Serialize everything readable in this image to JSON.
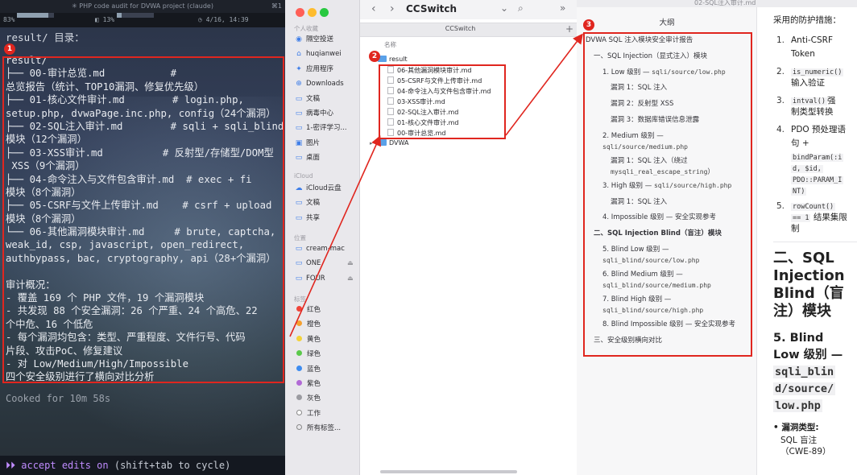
{
  "terminal": {
    "window_title": "✳ PHP code audit for DVWA project (claude)",
    "window_shortcut": "⌘1",
    "status": {
      "cpu_label": "83%",
      "cpu_value": 83,
      "mem_label": "13%",
      "mem_value": 13,
      "clock": "4/16, 14:39"
    },
    "prompt": "result/ 目录：",
    "tree_lines": [
      "result/",
      "├── 00-审计总览.md           #",
      "总览报告（统计、TOP10漏洞、修复优先级）",
      "├── 01-核心文件审计.md        # login.php,",
      "setup.php, dvwaPage.inc.php, config（24个漏洞）",
      "├── 02-SQL注入审计.md        # sqli + sqli_blind",
      "模块（12个漏洞）",
      "├── 03-XSS审计.md          # 反射型/存储型/DOM型",
      " XSS（9个漏洞）",
      "├── 04-命令注入与文件包含审计.md  # exec + fi",
      "模块（8个漏洞）",
      "├── 05-CSRF与文件上传审计.md    # csrf + upload",
      "模块（8个漏洞）",
      "└── 06-其他漏洞模块审计.md     # brute, captcha,",
      "weak_id, csp, javascript, open_redirect,",
      "authbypass, bac, cryptography, api（28+个漏洞）",
      "",
      "审计概况：",
      "- 覆盖 169 个 PHP 文件，19 个漏洞模块",
      "- 共发现 88 个安全漏洞：26 个严重、24 个高危、22",
      "个中危、16 个低危",
      "- 每个漏洞均包含：类型、严重程度、文件行号、代码",
      "片段、攻击PoC、修复建议",
      "- 对 Low/Medium/High/Impossible",
      "四个安全级别进行了横向对比分析"
    ],
    "cooked": "Cooked for 10m 58s",
    "footer_prefix": "⏵⏵",
    "footer_accent": "accept edits on",
    "footer_hint": "(shift+tab to cycle)"
  },
  "badges": [
    "1",
    "2",
    "3"
  ],
  "finder": {
    "sidebar": {
      "section_personal": "个人收藏",
      "personal": [
        {
          "label": "隔空投送",
          "icon": "airdrop-icon",
          "glyph": "◉"
        },
        {
          "label": "huqianwei",
          "icon": "home-icon",
          "glyph": "⌂"
        },
        {
          "label": "应用程序",
          "icon": "applications-icon",
          "glyph": "✦"
        },
        {
          "label": "Downloads",
          "icon": "downloads-icon",
          "glyph": "⊕"
        },
        {
          "label": "文稿",
          "icon": "documents-icon",
          "glyph": "▭"
        },
        {
          "label": "病毒中心",
          "icon": "folder-icon",
          "glyph": "▭"
        },
        {
          "label": "1-密评学习...",
          "icon": "folder-icon",
          "glyph": "▭"
        },
        {
          "label": "图片",
          "icon": "pictures-icon",
          "glyph": "▣"
        },
        {
          "label": "桌面",
          "icon": "desktop-icon",
          "glyph": "▭"
        }
      ],
      "section_icloud": "iCloud",
      "icloud": [
        {
          "label": "iCloud云盘",
          "icon": "icloud-icon",
          "glyph": "☁"
        },
        {
          "label": "文稿",
          "icon": "documents-icon",
          "glyph": "▭"
        },
        {
          "label": "共享",
          "icon": "shared-icon",
          "glyph": "▭"
        }
      ],
      "section_locations": "位置",
      "locations": [
        {
          "label": "cream-mac",
          "icon": "computer-icon",
          "glyph": "▭",
          "eject": ""
        },
        {
          "label": "ONE",
          "icon": "drive-icon",
          "glyph": "▭",
          "eject": "⏏"
        },
        {
          "label": "FOUR",
          "icon": "drive-icon",
          "glyph": "▭",
          "eject": "⏏"
        }
      ],
      "section_tags": "标签",
      "tags": [
        {
          "label": "红色",
          "color": "#f0443a"
        },
        {
          "label": "橙色",
          "color": "#f5a02f"
        },
        {
          "label": "黄色",
          "color": "#f3d23b"
        },
        {
          "label": "绿色",
          "color": "#5bc94b"
        },
        {
          "label": "蓝色",
          "color": "#3e8cf0"
        },
        {
          "label": "紫色",
          "color": "#b26ad6"
        },
        {
          "label": "灰色",
          "color": "#9b9ba1"
        },
        {
          "label": "工作",
          "color": "#ffffff"
        },
        {
          "label": "所有标签...",
          "color": ""
        }
      ]
    },
    "toolbar": {
      "back": "‹",
      "forward": "›",
      "title": "CCSwitch",
      "chevron": "⌄",
      "search": "⌕",
      "more": "»"
    },
    "tab": "CCSwitch",
    "plus": "+",
    "column_name": "名称",
    "root_folder": "result",
    "files": [
      "06-其他漏洞模块审计.md",
      "05-CSRF与文件上传审计.md",
      "04-命令注入与文件包含审计.md",
      "03-XSS审计.md",
      "02-SQL注入审计.md",
      "01-核心文件审计.md",
      "00-审计总览.md"
    ],
    "sibling_folder": "DVWA"
  },
  "markdown": {
    "window_title": "02-SQL注入审计.md",
    "toc_title": "大纲",
    "toc": [
      {
        "text": "DVWA SQL 注入模块安全审计报告",
        "level": 0,
        "code": ""
      },
      {
        "text": "一、SQL Injection（显式注入）模块",
        "level": 1,
        "code": ""
      },
      {
        "text": "1. Low 级别 — ",
        "level": 2,
        "code": "sqli/source/low.php"
      },
      {
        "text": "漏洞 1：SQL 注入",
        "level": 3,
        "code": ""
      },
      {
        "text": "漏洞 2：反射型 XSS",
        "level": 3,
        "code": ""
      },
      {
        "text": "漏洞 3：数据库错误信息泄露",
        "level": 3,
        "code": ""
      },
      {
        "text": "2. Medium 级别 —",
        "level": 2,
        "code": ""
      },
      {
        "text": "",
        "level": 2,
        "code": "sqli/source/medium.php"
      },
      {
        "text": "漏洞 1：SQL 注入（绕过",
        "level": 3,
        "code": ""
      },
      {
        "text": "",
        "level": 3,
        "code": "mysqli_real_escape_string",
        "suffix": "）"
      },
      {
        "text": "3. High 级别 — ",
        "level": 2,
        "code": "sqli/source/high.php"
      },
      {
        "text": "漏洞 1：SQL 注入",
        "level": 3,
        "code": ""
      },
      {
        "text": "4. Impossible 级别 — 安全实现参考",
        "level": 2,
        "code": ""
      },
      {
        "text": "二、SQL Injection Blind（盲注）模块",
        "level": 1,
        "code": "",
        "bold": true
      },
      {
        "text": "5. Blind Low 级别 —",
        "level": 2,
        "code": ""
      },
      {
        "text": "",
        "level": 2,
        "code": "sqli_blind/source/low.php"
      },
      {
        "text": "6. Blind Medium 级别 —",
        "level": 2,
        "code": ""
      },
      {
        "text": "",
        "level": 2,
        "code": "sqli_blind/source/medium.php"
      },
      {
        "text": "7. Blind High 级别 —",
        "level": 2,
        "code": ""
      },
      {
        "text": "",
        "level": 2,
        "code": "sqli_blind/source/high.php"
      },
      {
        "text": "8. Blind Impossible 级别 — 安全实现参考",
        "level": 2,
        "code": ""
      },
      {
        "text": "三、安全级别横向对比",
        "level": 1,
        "code": ""
      }
    ],
    "content": {
      "measures_heading": "采用的防护措施：",
      "measures": [
        {
          "num": "1.",
          "lines": [
            [
              "text",
              "Anti-CSRF"
            ],
            [
              "text",
              "Token"
            ]
          ]
        },
        {
          "num": "2.",
          "lines": [
            [
              "mono",
              "is_numeric()"
            ],
            [
              "text",
              "输入验证"
            ]
          ]
        },
        {
          "num": "3.",
          "lines": [
            [
              "mono",
              "intval()",
              "强"
            ],
            [
              "text",
              "制类型转换"
            ]
          ]
        },
        {
          "num": "4.",
          "lines": [
            [
              "text",
              "PDO 预处理语"
            ],
            [
              "text",
              "句 +"
            ],
            [
              "mono",
              "bindParam(:i"
            ],
            [
              "mono",
              "d, $id,"
            ],
            [
              "mono",
              "PDO::PARAM_I"
            ],
            [
              "mono",
              "NT)"
            ]
          ]
        },
        {
          "num": "5.",
          "lines": [
            [
              "mono",
              "rowCount()"
            ],
            [
              "mono",
              "== 1",
              " 结果集限"
            ],
            [
              "text",
              "制"
            ]
          ]
        }
      ],
      "h2_lines": [
        "二、SQL",
        "Injection",
        "Blind（盲",
        "注）模块"
      ],
      "h3_prefix": "5. Blind",
      "h3_line2": "Low 级别 —",
      "h3_code": [
        "sqli_blin",
        "d/source/",
        "low.php"
      ],
      "bullet_label": "漏洞类型:",
      "bullet_value": "SQL 盲注",
      "bullet_cut": "（CWE-89）"
    }
  }
}
